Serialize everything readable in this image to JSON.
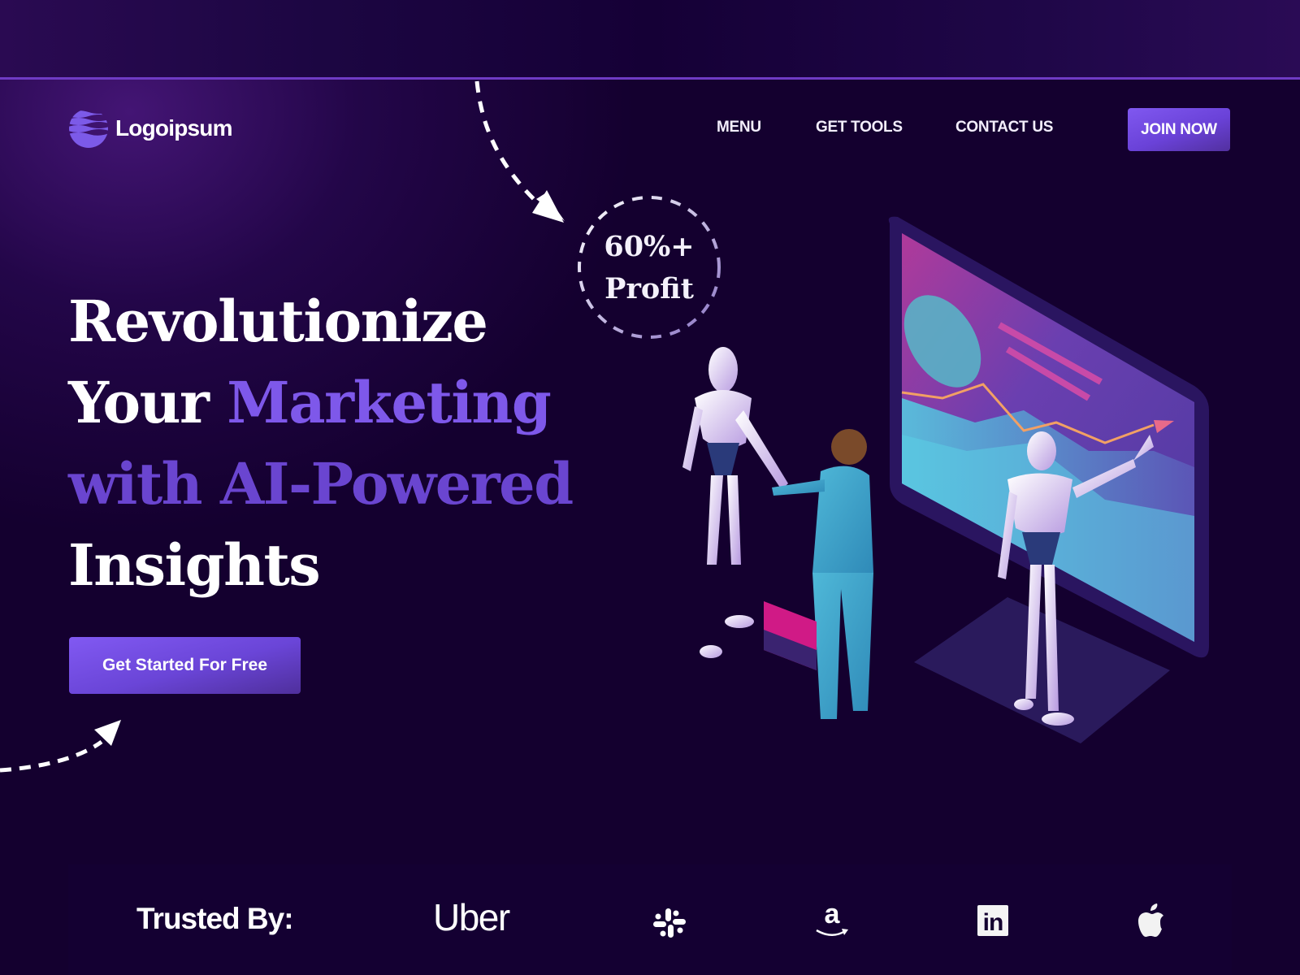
{
  "brand": {
    "name": "Logoipsum",
    "icon": "wave-globe-logo"
  },
  "nav": {
    "items": [
      {
        "label": "MENU"
      },
      {
        "label": "GET TOOLS"
      },
      {
        "label": "CONTACT US"
      }
    ],
    "cta_label": "JOIN NOW"
  },
  "hero": {
    "headline": {
      "line1": "Revolutionize",
      "line2_white": "Your ",
      "line2_accent": "Marketing",
      "line3": "with AI-Powered",
      "line4": "Insights"
    },
    "cta_label": "Get Started For Free",
    "badge": {
      "value": "60%+",
      "label": "Profit"
    },
    "illustration": "robots-handshake-analytics-monitor"
  },
  "trusted": {
    "label": "Trusted By:",
    "logos": [
      {
        "name": "Uber",
        "text": "Uber",
        "icon": "uber-wordmark"
      },
      {
        "name": "Slack",
        "icon": "slack-icon"
      },
      {
        "name": "Amazon",
        "icon": "amazon-icon",
        "text": "a"
      },
      {
        "name": "LinkedIn",
        "icon": "linkedin-icon",
        "text": "in"
      },
      {
        "name": "Apple",
        "icon": "apple-icon"
      }
    ]
  },
  "colors": {
    "background": "#14002f",
    "accent": "#7e58ea",
    "accent_dark": "#6a45d0",
    "divider": "#6f3bc4"
  }
}
